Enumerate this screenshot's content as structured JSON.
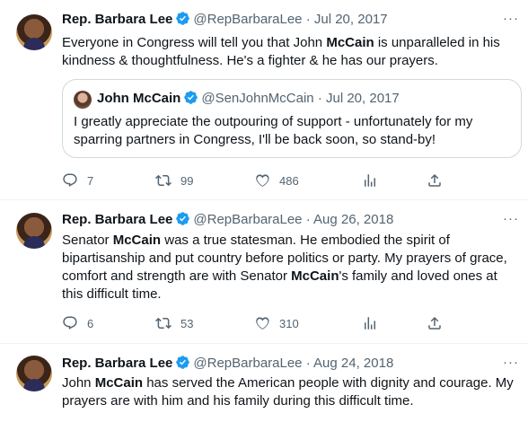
{
  "tweets": [
    {
      "name": "Rep. Barbara Lee",
      "handle": "@RepBarbaraLee",
      "dot": "·",
      "date": "Jul 20, 2017",
      "more": "···",
      "text_parts": [
        "Everyone in Congress will tell you that John ",
        "McCain",
        " is unparalleled in his kindness & thoughtfulness. He's a fighter & he has our prayers."
      ],
      "quote": {
        "name": "John McCain",
        "handle": "@SenJohnMcCain",
        "dot": "·",
        "date": "Jul 20, 2017",
        "text": "I greatly appreciate the outpouring of support - unfortunately for my sparring partners in Congress, I'll be back soon, so stand-by!"
      },
      "replies": "7",
      "retweets": "99",
      "likes": "486"
    },
    {
      "name": "Rep. Barbara Lee",
      "handle": "@RepBarbaraLee",
      "dot": "·",
      "date": "Aug 26, 2018",
      "more": "···",
      "text_parts": [
        "Senator ",
        "McCain",
        " was a true statesman. He embodied the spirit of bipartisanship and put country before politics or party. My prayers of grace, comfort and strength are with Senator ",
        "McCain",
        "'s family and loved ones at this difficult time."
      ],
      "replies": "6",
      "retweets": "53",
      "likes": "310"
    },
    {
      "name": "Rep. Barbara Lee",
      "handle": "@RepBarbaraLee",
      "dot": "·",
      "date": "Aug 24, 2018",
      "more": "···",
      "text_parts": [
        "John ",
        "McCain",
        " has served the American people with dignity and courage. My prayers are with him and his family during this difficult time."
      ]
    }
  ],
  "icons": {
    "verified": "verified-badge-icon",
    "reply": "reply-icon",
    "retweet": "retweet-icon",
    "like": "heart-icon",
    "views": "analytics-icon",
    "share": "share-icon"
  },
  "colors": {
    "verified": "#1d9bf0",
    "secondary_text": "#536471",
    "border": "#cfd9de"
  }
}
